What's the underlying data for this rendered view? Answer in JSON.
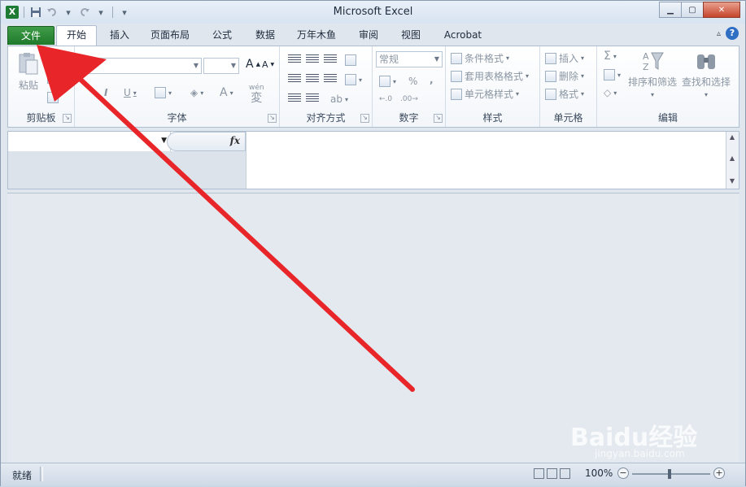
{
  "window": {
    "title": "Microsoft Excel"
  },
  "qat": {
    "logo_letter": "X"
  },
  "tabs": {
    "file": "文件",
    "items": [
      "开始",
      "插入",
      "页面布局",
      "公式",
      "数据",
      "万年木鱼",
      "审阅",
      "视图",
      "Acrobat"
    ]
  },
  "ribbon": {
    "clipboard": {
      "paste": "粘贴",
      "label": "剪贴板"
    },
    "font": {
      "label": "字体",
      "grow": "A",
      "shrink": "A",
      "underline": "U",
      "font_color": "A",
      "phonetic": "wén"
    },
    "alignment": {
      "label": "对齐方式"
    },
    "number": {
      "label": "数字",
      "format": "常规",
      "percent": "%",
      "comma": ","
    },
    "styles": {
      "label": "样式",
      "conditional": "条件格式",
      "table": "套用表格格式",
      "cell": "单元格样式"
    },
    "cells": {
      "label": "单元格",
      "insert": "插入",
      "delete": "删除",
      "format": "格式"
    },
    "editing": {
      "label": "编辑",
      "sigma": "Σ",
      "sort": "排序和筛选",
      "find": "查找和选择"
    }
  },
  "formula_bar": {
    "fx": "fx"
  },
  "status": {
    "ready": "就绪",
    "zoom": "100%"
  },
  "watermark": {
    "brand": "Baidu经验",
    "url": "jingyan.baidu.com"
  },
  "colors": {
    "file_tab": "#2a8a35",
    "arrow": "#e8262a"
  }
}
